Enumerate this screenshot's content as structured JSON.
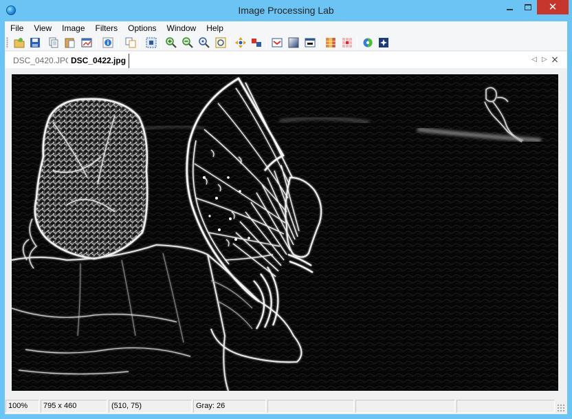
{
  "window": {
    "title": "Image Processing Lab",
    "icon": "globe-icon"
  },
  "menu": [
    "File",
    "View",
    "Image",
    "Filters",
    "Options",
    "Window",
    "Help"
  ],
  "toolbar": {
    "buttons": [
      {
        "name": "open-file-icon"
      },
      {
        "name": "save-icon"
      },
      {
        "name": "copy-icon"
      },
      {
        "name": "paste-icon"
      },
      {
        "name": "open-in-new-window-icon"
      },
      {
        "name": "info-icon"
      },
      {
        "name": "clone-icon"
      },
      {
        "name": "crop-selection-icon"
      },
      {
        "name": "zoom-in-icon"
      },
      {
        "name": "zoom-out-icon"
      },
      {
        "name": "zoom-actual-icon"
      },
      {
        "name": "zoom-fit-icon"
      },
      {
        "name": "pan-icon"
      },
      {
        "name": "flip-icon"
      },
      {
        "name": "histogram-icon"
      },
      {
        "name": "levels-icon"
      },
      {
        "name": "statistics-icon"
      },
      {
        "name": "rgb-channels-icon"
      },
      {
        "name": "filter-grid-icon"
      },
      {
        "name": "color-icon"
      },
      {
        "name": "effects-icon"
      }
    ]
  },
  "tabs": [
    {
      "label": "DSC_0420.JPG",
      "active": false
    },
    {
      "label": "DSC_0422.jpg",
      "active": true
    }
  ],
  "tab_nav": {
    "prev": "◁",
    "next": "▷",
    "close": "×"
  },
  "image": {
    "description_name": "edge-detected-photo",
    "width": 795,
    "height": 460
  },
  "status": {
    "zoom": "100%",
    "size": "795 x 460",
    "coords": "(510, 75)",
    "color": "Gray: 26",
    "extra1": "",
    "extra2": "",
    "extra3": ""
  },
  "colors": {
    "title_bar": "#6cc4f5",
    "close": "#c7362d",
    "canvas": "#040404"
  }
}
